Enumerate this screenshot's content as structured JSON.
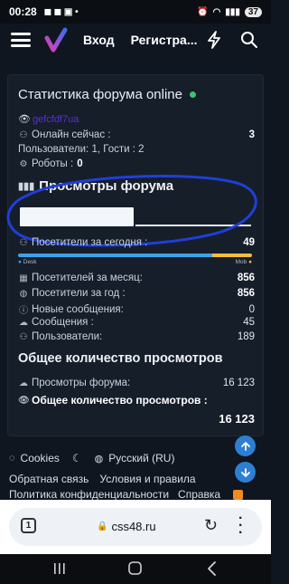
{
  "status": {
    "time": "00:28",
    "battery": "37"
  },
  "nav": {
    "login": "Вход",
    "register": "Регистра..."
  },
  "stats": {
    "title": "Статистика форума online",
    "online_now_label": "Онлайн сейчас :",
    "online_now_value": "3",
    "users_guests": "Пользователи: 1, Гости : 2",
    "robots_label": "Роботы :",
    "robots_value": "0",
    "online_user": "gefcfdf7ua"
  },
  "views": {
    "title": "Просмотры форума",
    "today_label": "Посетители за сегодня :",
    "today_value": "49",
    "desk_label": "Desk",
    "mob_label": "Mob",
    "desk_share": 0.83,
    "month_label": "Посетителей за месяц:",
    "month_value": "856",
    "year_label": "Посетители за год :",
    "year_value": "856",
    "new_messages_label": "Новые сообщения:",
    "new_messages_value": "0",
    "messages_label": "Сообщения :",
    "messages_value": "45",
    "users_label": "Пользователи:",
    "users_value": "189"
  },
  "totals": {
    "title": "Общее количество просмотров",
    "forum_views_label": "Просмотры форума:",
    "forum_views_value": "16 123",
    "total_label": "Общее количество просмотров :",
    "total_value": "16 123"
  },
  "footer": {
    "cookies": "Cookies",
    "language": "Русский (RU)",
    "feedback": "Обратная связь",
    "terms": "Условия и правила",
    "privacy": "Политика конфиденциальности",
    "help": "Справка"
  },
  "browser": {
    "url": "css48.ru",
    "tabs": "1"
  },
  "colors": {
    "accent": "#2d7fd4",
    "online_dot": "#3cc36f",
    "desk": "#3fa1e6",
    "mob": "#f2bf3c",
    "background": "#0f1620"
  }
}
